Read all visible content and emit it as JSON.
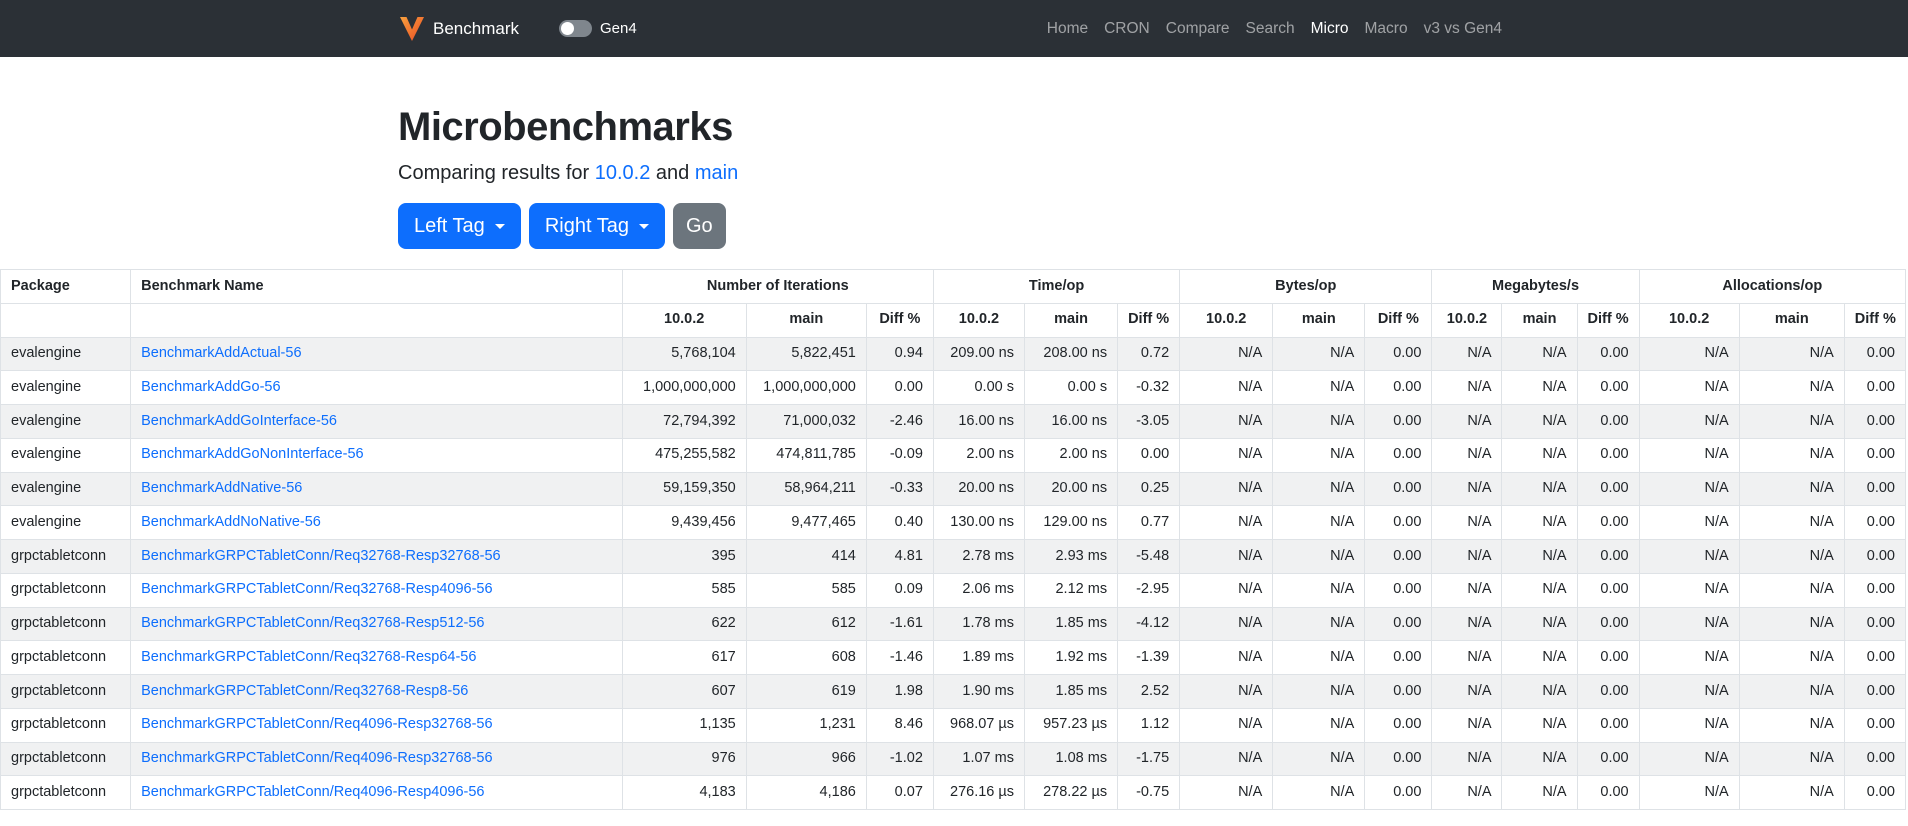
{
  "navbar": {
    "brand": "Benchmark",
    "toggle_label": "Gen4",
    "links": [
      {
        "label": "Home",
        "active": false
      },
      {
        "label": "CRON",
        "active": false
      },
      {
        "label": "Compare",
        "active": false
      },
      {
        "label": "Search",
        "active": false
      },
      {
        "label": "Micro",
        "active": true
      },
      {
        "label": "Macro",
        "active": false
      },
      {
        "label": "v3 vs Gen4",
        "active": false
      }
    ]
  },
  "hero": {
    "title": "Microbenchmarks",
    "subtitle_prefix": "Comparing results for",
    "left_tag": "10.0.2",
    "conjunction": "and",
    "right_tag": "main",
    "left_button": "Left Tag",
    "right_button": "Right Tag",
    "go_button": "Go"
  },
  "table": {
    "package_header": "Package",
    "benchmark_header": "Benchmark Name",
    "groups": [
      "Number of Iterations",
      "Time/op",
      "Bytes/op",
      "Megabytes/s",
      "Allocations/op"
    ],
    "subcolumns": [
      "10.0.2",
      "main",
      "Diff %"
    ],
    "rows": [
      {
        "package": "evalengine",
        "benchmark": "BenchmarkAddActual-56",
        "values": [
          "5,768,104",
          "5,822,451",
          "0.94",
          "209.00 ns",
          "208.00 ns",
          "0.72",
          "N/A",
          "N/A",
          "0.00",
          "N/A",
          "N/A",
          "0.00",
          "N/A",
          "N/A",
          "0.00"
        ]
      },
      {
        "package": "evalengine",
        "benchmark": "BenchmarkAddGo-56",
        "values": [
          "1,000,000,000",
          "1,000,000,000",
          "0.00",
          "0.00 s",
          "0.00 s",
          "-0.32",
          "N/A",
          "N/A",
          "0.00",
          "N/A",
          "N/A",
          "0.00",
          "N/A",
          "N/A",
          "0.00"
        ]
      },
      {
        "package": "evalengine",
        "benchmark": "BenchmarkAddGoInterface-56",
        "values": [
          "72,794,392",
          "71,000,032",
          "-2.46",
          "16.00 ns",
          "16.00 ns",
          "-3.05",
          "N/A",
          "N/A",
          "0.00",
          "N/A",
          "N/A",
          "0.00",
          "N/A",
          "N/A",
          "0.00"
        ]
      },
      {
        "package": "evalengine",
        "benchmark": "BenchmarkAddGoNonInterface-56",
        "values": [
          "475,255,582",
          "474,811,785",
          "-0.09",
          "2.00 ns",
          "2.00 ns",
          "0.00",
          "N/A",
          "N/A",
          "0.00",
          "N/A",
          "N/A",
          "0.00",
          "N/A",
          "N/A",
          "0.00"
        ]
      },
      {
        "package": "evalengine",
        "benchmark": "BenchmarkAddNative-56",
        "values": [
          "59,159,350",
          "58,964,211",
          "-0.33",
          "20.00 ns",
          "20.00 ns",
          "0.25",
          "N/A",
          "N/A",
          "0.00",
          "N/A",
          "N/A",
          "0.00",
          "N/A",
          "N/A",
          "0.00"
        ]
      },
      {
        "package": "evalengine",
        "benchmark": "BenchmarkAddNoNative-56",
        "values": [
          "9,439,456",
          "9,477,465",
          "0.40",
          "130.00 ns",
          "129.00 ns",
          "0.77",
          "N/A",
          "N/A",
          "0.00",
          "N/A",
          "N/A",
          "0.00",
          "N/A",
          "N/A",
          "0.00"
        ]
      },
      {
        "package": "grpctabletconn",
        "benchmark": "BenchmarkGRPCTabletConn/Req32768-Resp32768-56",
        "values": [
          "395",
          "414",
          "4.81",
          "2.78 ms",
          "2.93 ms",
          "-5.48",
          "N/A",
          "N/A",
          "0.00",
          "N/A",
          "N/A",
          "0.00",
          "N/A",
          "N/A",
          "0.00"
        ]
      },
      {
        "package": "grpctabletconn",
        "benchmark": "BenchmarkGRPCTabletConn/Req32768-Resp4096-56",
        "values": [
          "585",
          "585",
          "0.09",
          "2.06 ms",
          "2.12 ms",
          "-2.95",
          "N/A",
          "N/A",
          "0.00",
          "N/A",
          "N/A",
          "0.00",
          "N/A",
          "N/A",
          "0.00"
        ]
      },
      {
        "package": "grpctabletconn",
        "benchmark": "BenchmarkGRPCTabletConn/Req32768-Resp512-56",
        "values": [
          "622",
          "612",
          "-1.61",
          "1.78 ms",
          "1.85 ms",
          "-4.12",
          "N/A",
          "N/A",
          "0.00",
          "N/A",
          "N/A",
          "0.00",
          "N/A",
          "N/A",
          "0.00"
        ]
      },
      {
        "package": "grpctabletconn",
        "benchmark": "BenchmarkGRPCTabletConn/Req32768-Resp64-56",
        "values": [
          "617",
          "608",
          "-1.46",
          "1.89 ms",
          "1.92 ms",
          "-1.39",
          "N/A",
          "N/A",
          "0.00",
          "N/A",
          "N/A",
          "0.00",
          "N/A",
          "N/A",
          "0.00"
        ]
      },
      {
        "package": "grpctabletconn",
        "benchmark": "BenchmarkGRPCTabletConn/Req32768-Resp8-56",
        "values": [
          "607",
          "619",
          "1.98",
          "1.90 ms",
          "1.85 ms",
          "2.52",
          "N/A",
          "N/A",
          "0.00",
          "N/A",
          "N/A",
          "0.00",
          "N/A",
          "N/A",
          "0.00"
        ]
      },
      {
        "package": "grpctabletconn",
        "benchmark": "BenchmarkGRPCTabletConn/Req4096-Resp32768-56",
        "values": [
          "1,135",
          "1,231",
          "8.46",
          "968.07 µs",
          "957.23 µs",
          "1.12",
          "N/A",
          "N/A",
          "0.00",
          "N/A",
          "N/A",
          "0.00",
          "N/A",
          "N/A",
          "0.00"
        ]
      },
      {
        "package": "grpctabletconn",
        "benchmark": "BenchmarkGRPCTabletConn/Req4096-Resp32768-56",
        "values": [
          "976",
          "966",
          "-1.02",
          "1.07 ms",
          "1.08 ms",
          "-1.75",
          "N/A",
          "N/A",
          "0.00",
          "N/A",
          "N/A",
          "0.00",
          "N/A",
          "N/A",
          "0.00"
        ]
      },
      {
        "package": "grpctabletconn",
        "benchmark": "BenchmarkGRPCTabletConn/Req4096-Resp4096-56",
        "values": [
          "4,183",
          "4,186",
          "0.07",
          "276.16 µs",
          "278.22 µs",
          "-0.75",
          "N/A",
          "N/A",
          "0.00",
          "N/A",
          "N/A",
          "0.00",
          "N/A",
          "N/A",
          "0.00"
        ]
      }
    ]
  },
  "colors": {
    "navbar_bg": "#2b3036",
    "accent_blue": "#0d6efd",
    "secondary_gray": "#6c757d",
    "logo_orange_light": "#f9a13e",
    "logo_orange_dark": "#ea4c24",
    "row_stripe": "#f0f1f2",
    "table_border": "#dee2e6"
  }
}
